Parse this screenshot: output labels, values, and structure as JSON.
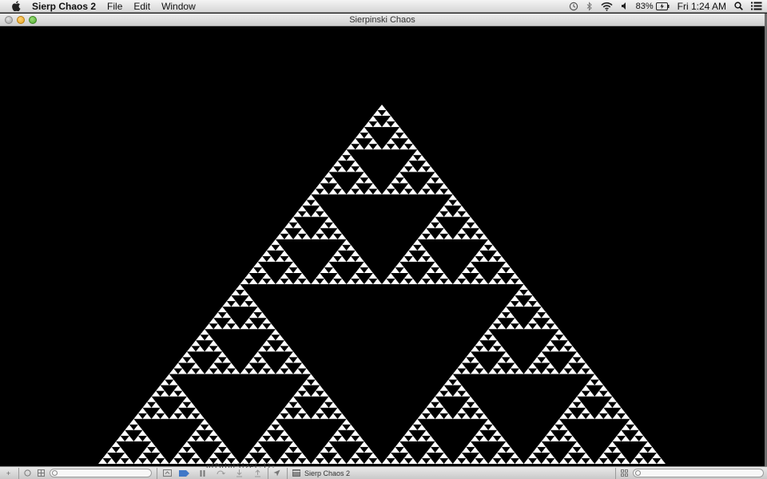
{
  "menubar": {
    "app_name": "Sierp Chaos 2",
    "menus": [
      "File",
      "Edit",
      "Window"
    ],
    "battery": "83%",
    "clock": "Fri 1:24 AM"
  },
  "window": {
    "title": "Sierpinski Chaos"
  },
  "canvas": {
    "background": "#000000",
    "fractal_color": "#ffffff",
    "fractal": "Sierpinski triangle",
    "depth": 6
  },
  "debugbar": {
    "target": "Sierp Chaos 2",
    "code_peek": "ofPointSize(.1);"
  }
}
